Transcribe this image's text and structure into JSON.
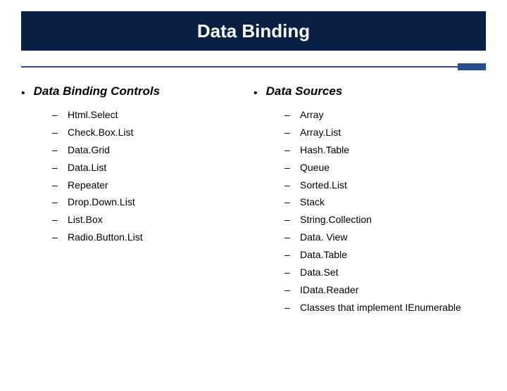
{
  "title": "Data Binding",
  "columns": [
    {
      "heading": "Data Binding Controls",
      "items": [
        "Html.Select",
        "Check.Box.List",
        "Data.Grid",
        "Data.List",
        "Repeater",
        "Drop.Down.List",
        "List.Box",
        "Radio.Button.List"
      ]
    },
    {
      "heading": "Data Sources",
      "items": [
        "Array",
        "Array.List",
        "Hash.Table",
        "Queue",
        "Sorted.List",
        "Stack",
        "String.Collection",
        "Data. View",
        "Data.Table",
        "Data.Set",
        "IData.Reader",
        "Classes that implement IEnumerable"
      ]
    }
  ]
}
